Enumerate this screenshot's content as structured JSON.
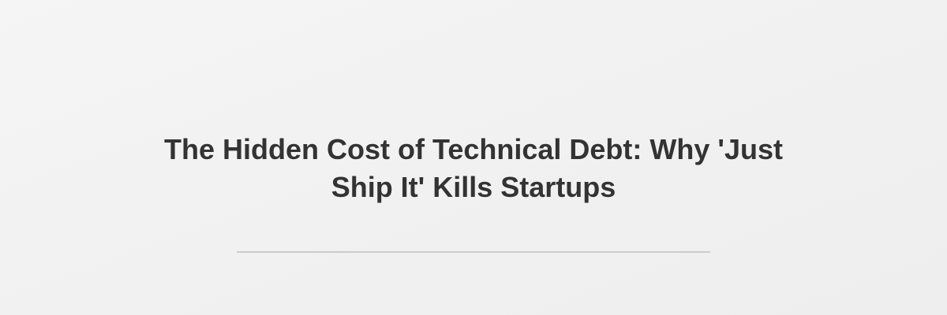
{
  "article": {
    "title": "The Hidden Cost of Technical Debt: Why 'Just Ship It' Kills Startups"
  },
  "colors": {
    "title_text": "#333333",
    "divider": "#cccccc",
    "background": "#f2f2f2"
  }
}
